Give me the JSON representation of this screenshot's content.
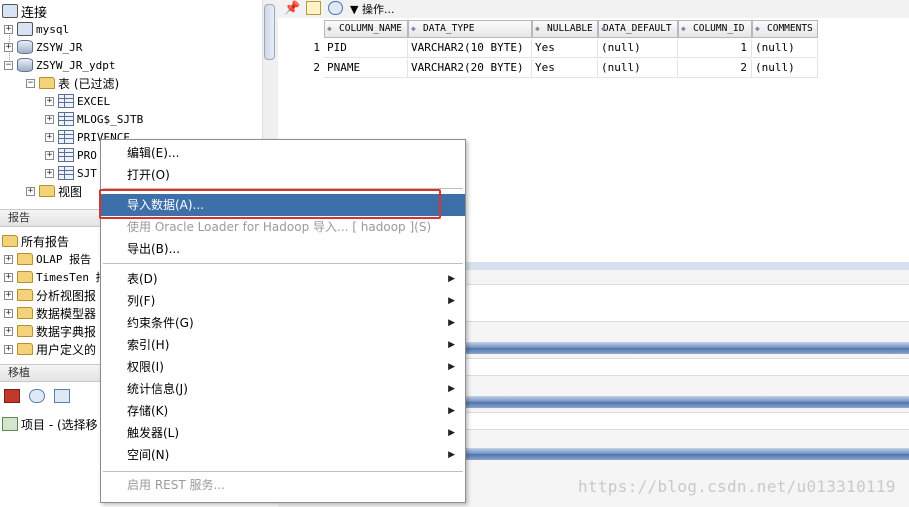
{
  "connections": {
    "header": "连接",
    "items": [
      {
        "label": "mysql"
      },
      {
        "label": "ZSYW_JR"
      },
      {
        "label": "ZSYW_JR_ydpt"
      },
      {
        "label": "表 (已过滤)"
      },
      {
        "label": "EXCEL"
      },
      {
        "label": "MLOG$_SJTB"
      },
      {
        "label": "PRIVENCE"
      },
      {
        "label": "PRO"
      },
      {
        "label": "SJT"
      },
      {
        "label": "视图"
      }
    ]
  },
  "reports": {
    "header": "报告",
    "items": [
      {
        "label": "所有报告"
      },
      {
        "label": "OLAP 报告"
      },
      {
        "label": "TimesTen 报"
      },
      {
        "label": "分析视图报"
      },
      {
        "label": "数据模型器"
      },
      {
        "label": "数据字典报"
      },
      {
        "label": "用户定义的"
      }
    ]
  },
  "migration": {
    "header": "移植",
    "project_label": "项目 - (选择移"
  },
  "toolbar": {
    "actions_label": "操作..."
  },
  "grid": {
    "columns": [
      "COLUMN_NAME",
      "DATA_TYPE",
      "NULLABLE",
      "DATA_DEFAULT",
      "COLUMN_ID",
      "COMMENTS"
    ],
    "rows": [
      {
        "num": "1",
        "cells": [
          "PID",
          "VARCHAR2(10 BYTE)",
          "Yes",
          "(null)",
          "1",
          "(null)"
        ]
      },
      {
        "num": "2",
        "cells": [
          "PNAME",
          "VARCHAR2(20 BYTE)",
          "Yes",
          "(null)",
          "2",
          "(null)"
        ]
      }
    ]
  },
  "context_menu": {
    "items": [
      {
        "label": "编辑(E)...",
        "state": "normal"
      },
      {
        "label": "打开(O)",
        "state": "normal"
      },
      {
        "label": "导入数据(A)...",
        "state": "selected"
      },
      {
        "label": "使用 Oracle Loader for Hadoop 导入... [ hadoop ](S)",
        "state": "disabled"
      },
      {
        "label": "导出(B)...",
        "state": "normal"
      },
      {
        "label": "表(D)",
        "state": "submenu"
      },
      {
        "label": "列(F)",
        "state": "submenu"
      },
      {
        "label": "约束条件(G)",
        "state": "submenu"
      },
      {
        "label": "索引(H)",
        "state": "submenu"
      },
      {
        "label": "权限(I)",
        "state": "submenu"
      },
      {
        "label": "统计信息(J)",
        "state": "submenu"
      },
      {
        "label": "存储(K)",
        "state": "submenu"
      },
      {
        "label": "触发器(L)",
        "state": "submenu"
      },
      {
        "label": "空间(N)",
        "state": "submenu"
      },
      {
        "label": "启用 REST 服务...",
        "state": "disabled"
      }
    ]
  },
  "watermark": "https://blog.csdn.net/u013310119",
  "colors": {
    "menu_selected": "#3d6fa8",
    "highlight_box": "#d9342b",
    "blue_bar": "#4f74ad"
  }
}
